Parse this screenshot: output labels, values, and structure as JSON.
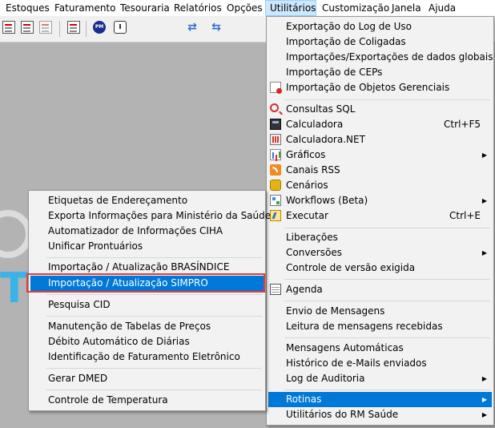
{
  "menubar": {
    "items": [
      {
        "label": "Estoques"
      },
      {
        "label": "Faturamento"
      },
      {
        "label": "Tesouraria"
      },
      {
        "label": "Relatórios"
      },
      {
        "label": "Opções"
      },
      {
        "label": "Utilitários"
      },
      {
        "label": "Customização"
      },
      {
        "label": "Janela"
      },
      {
        "label": "Ajuda"
      }
    ]
  },
  "background": {
    "logo_text": "TO"
  },
  "utilitarios_menu": {
    "items": [
      {
        "label": "Exportação do Log de Uso"
      },
      {
        "label": "Importação de Coligadas"
      },
      {
        "label": "Importações/Exportações de dados globais"
      },
      {
        "label": "Importação de CEPs"
      },
      {
        "label": "Importação de Objetos Gerenciais"
      },
      {
        "label": "Consultas SQL"
      },
      {
        "label": "Calculadora",
        "shortcut": "Ctrl+F5"
      },
      {
        "label": "Calculadora.NET"
      },
      {
        "label": "Gráficos"
      },
      {
        "label": "Canais RSS"
      },
      {
        "label": "Cenários"
      },
      {
        "label": "Workflows (Beta)"
      },
      {
        "label": "Executar",
        "shortcut": "Ctrl+E"
      },
      {
        "label": "Liberações"
      },
      {
        "label": "Conversões"
      },
      {
        "label": "Controle de versão exigida"
      },
      {
        "label": "Agenda"
      },
      {
        "label": "Envio de Mensagens"
      },
      {
        "label": "Leitura de mensagens recebidas"
      },
      {
        "label": "Mensagens Automáticas"
      },
      {
        "label": "Histórico de e-Mails enviados"
      },
      {
        "label": "Log de Auditoria"
      },
      {
        "label": "Rotinas"
      },
      {
        "label": "Utilitários do RM Saúde"
      }
    ]
  },
  "rotinas_menu": {
    "items": [
      {
        "label": "Etiquetas de Endereçamento"
      },
      {
        "label": "Exporta Informações para Ministério da Saúde"
      },
      {
        "label": "Automatizador de Informações CIHA"
      },
      {
        "label": "Unificar Prontuários"
      },
      {
        "label": "Importação / Atualização BRASÍNDICE"
      },
      {
        "label": "Importação / Atualização SIMPRO"
      },
      {
        "label": "Pesquisa CID"
      },
      {
        "label": "Manutenção de Tabelas de Preços"
      },
      {
        "label": "Débito Automático de Diárias"
      },
      {
        "label": "Identificação de Faturamento Eletrônico"
      },
      {
        "label": "Gerar DMED"
      },
      {
        "label": "Controle de Temperatura"
      }
    ]
  },
  "colors": {
    "highlight": "#0078d7",
    "annotation_box": "#e43b3b"
  }
}
